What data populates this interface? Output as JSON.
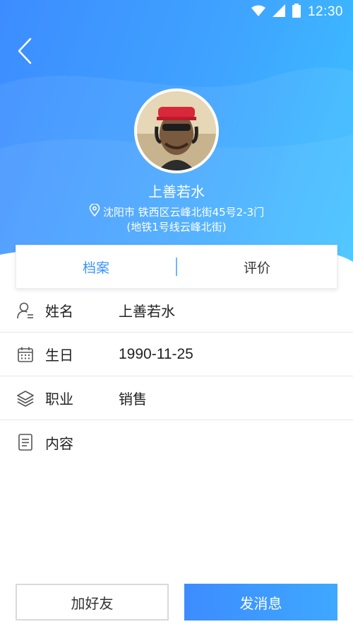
{
  "status_bar": {
    "time": "12:30",
    "icons": [
      "wifi-icon",
      "signal-icon",
      "battery-icon"
    ]
  },
  "header": {
    "back_icon": "chevron-left-icon",
    "user_name": "上善若水",
    "address_line1": "沈阳市 铁西区云峰北街45号2-3门",
    "address_line2": "(地铁1号线云峰北街)",
    "location_icon": "location-pin-icon"
  },
  "tabs": [
    {
      "label": "档案",
      "active": true
    },
    {
      "label": "评价",
      "active": false
    }
  ],
  "rows": [
    {
      "icon": "person-list-icon",
      "label": "姓名",
      "value": "上善若水"
    },
    {
      "icon": "calendar-icon",
      "label": "生日",
      "value": "1990-11-25"
    },
    {
      "icon": "layers-icon",
      "label": "职业",
      "value": "销售"
    },
    {
      "icon": "document-icon",
      "label": "内容",
      "value": ""
    }
  ],
  "buttons": {
    "add_friend": "加好友",
    "send_message": "发消息"
  },
  "colors": {
    "accent": "#3a94ff",
    "header_start": "#3d8cff",
    "header_end": "#3bc2ff"
  }
}
